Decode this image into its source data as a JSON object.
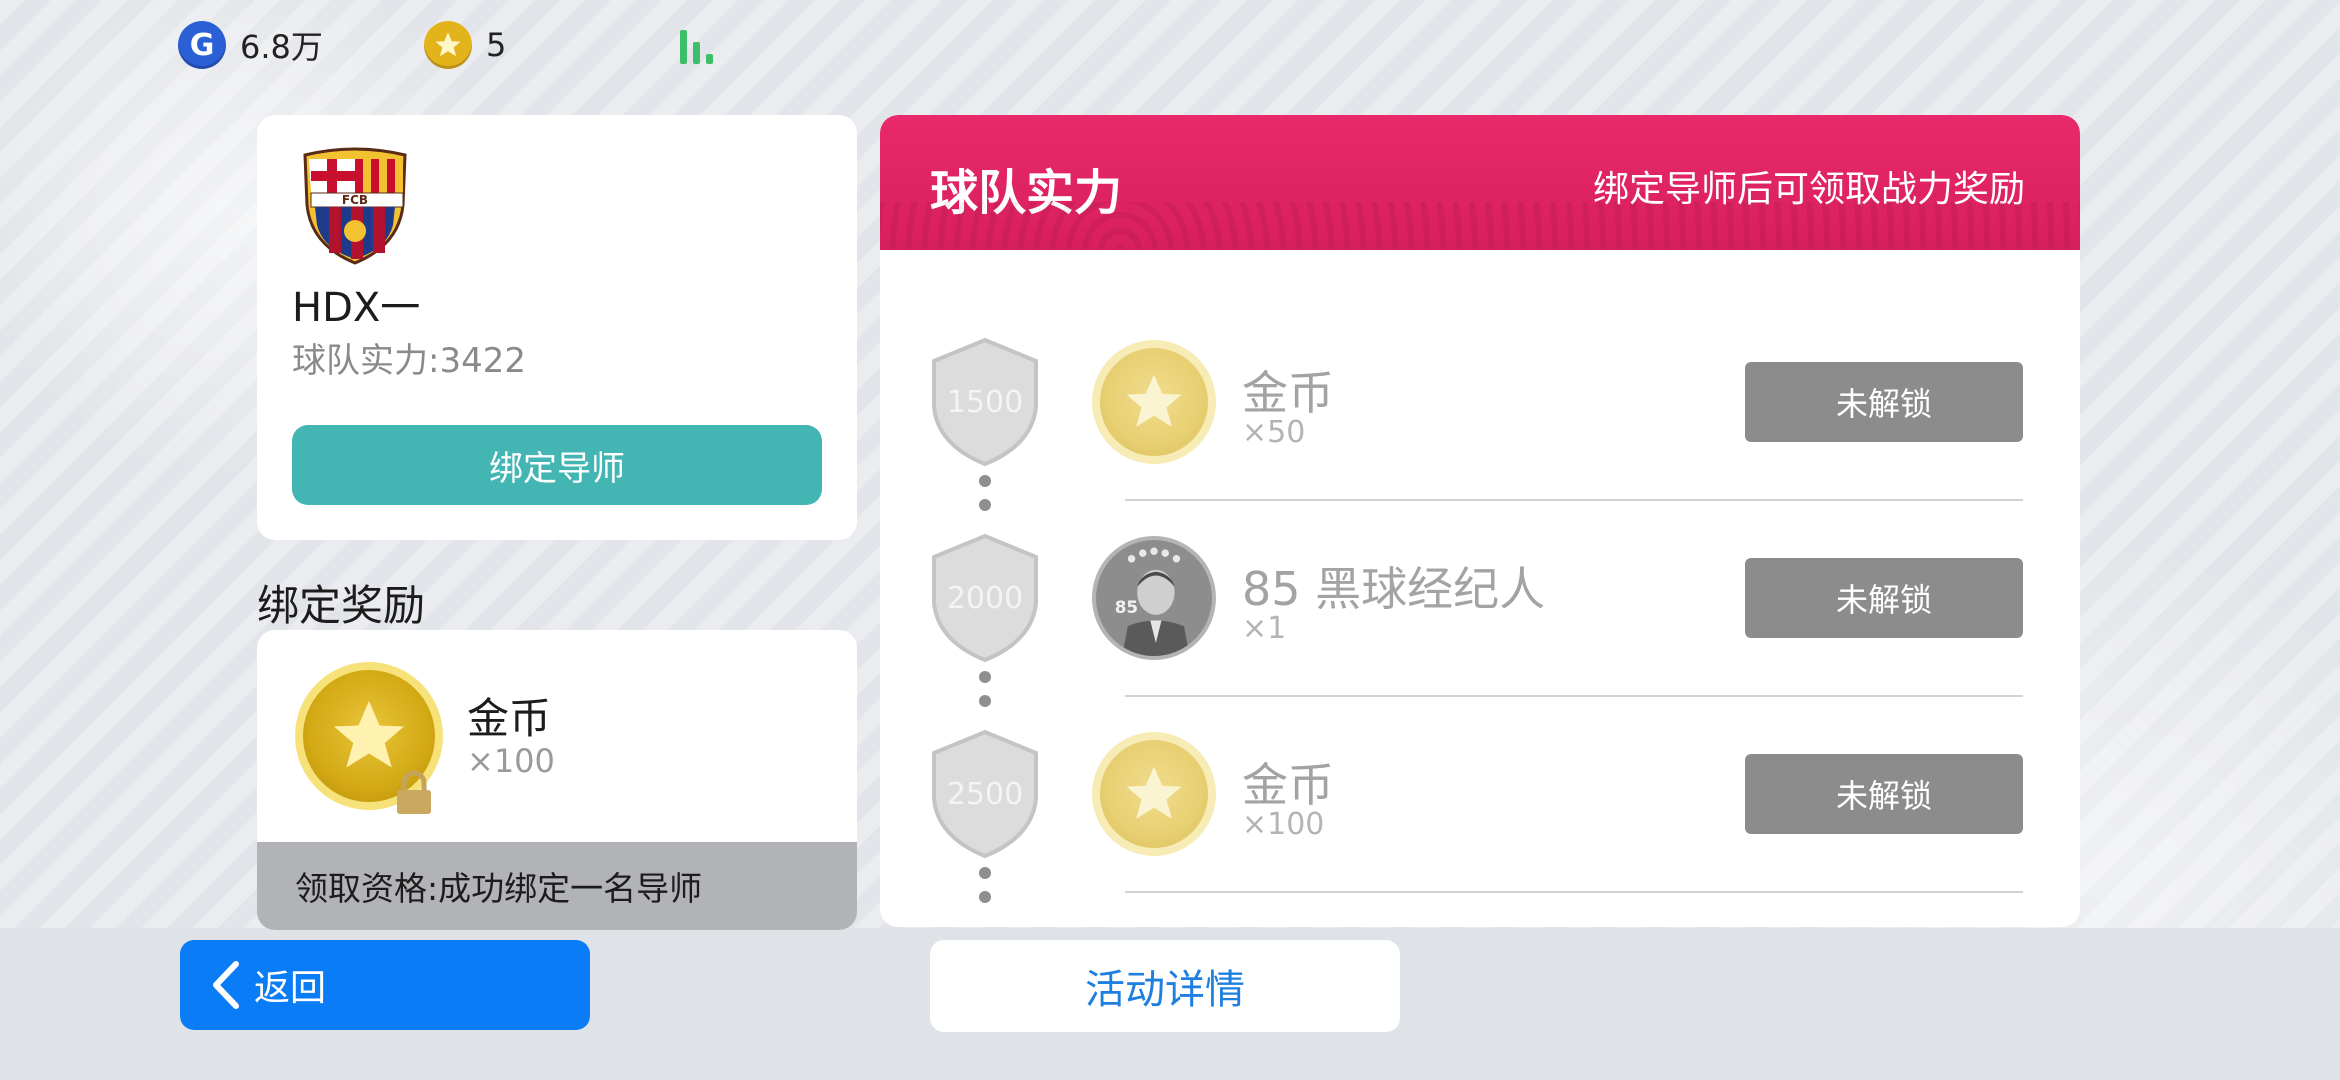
{
  "currency": {
    "g_coin_symbol": "G",
    "g_coin_amount": "6.8万",
    "gold_coin_amount": "5",
    "signal_icon": "signal-bars-icon"
  },
  "profile": {
    "club_logo_text": "FCB",
    "team_name": "HDX一",
    "team_power": "球队实力:3422",
    "bind_button_label": "绑定导师"
  },
  "bind_reward": {
    "section_title": "绑定奖励",
    "reward_name": "金币",
    "reward_qty": "×100",
    "eligibility": "领取资格:成功绑定一名导师"
  },
  "team_power_panel": {
    "title": "球队实力",
    "subtitle": "绑定导师后可领取战力奖励",
    "tiers": [
      {
        "threshold": "1500",
        "reward_name": "金币",
        "reward_qty": "×50",
        "icon": "gold-coin-icon",
        "button_label": "未解锁"
      },
      {
        "threshold": "2000",
        "reward_name": "85 黑球经纪人",
        "reward_qty": "×1",
        "icon": "player-agent-icon",
        "badge": "85",
        "button_label": "未解锁"
      },
      {
        "threshold": "2500",
        "reward_name": "金币",
        "reward_qty": "×100",
        "icon": "gold-coin-icon",
        "button_label": "未解锁"
      }
    ]
  },
  "footer": {
    "back_label": "返回",
    "details_label": "活动详情"
  },
  "colors": {
    "header_pink": "#e8296a",
    "teal_button": "#43b5b2",
    "back_blue": "#0a7cf5",
    "locked_gray": "#8c8c8c"
  }
}
